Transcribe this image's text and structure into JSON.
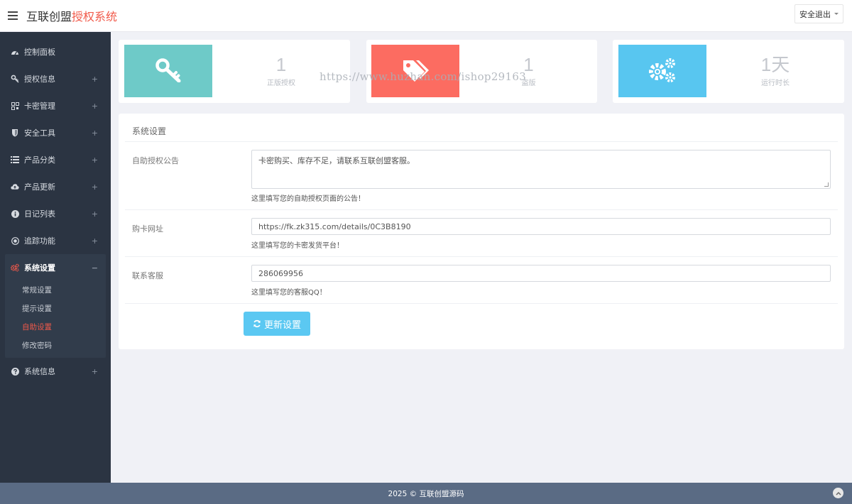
{
  "header": {
    "title_part1": "互联创盟",
    "title_part2": "授权系统",
    "logout_label": "安全退出"
  },
  "sidebar": {
    "items": [
      {
        "label": "控制面板",
        "icon": "dashboard-icon",
        "has_plus": false
      },
      {
        "label": "授权信息",
        "icon": "key-icon",
        "has_plus": true
      },
      {
        "label": "卡密管理",
        "icon": "qrcode-icon",
        "has_plus": true
      },
      {
        "label": "安全工具",
        "icon": "shield-icon",
        "has_plus": true
      },
      {
        "label": "产品分类",
        "icon": "list-icon",
        "has_plus": true
      },
      {
        "label": "产品更新",
        "icon": "cloud-upload-icon",
        "has_plus": true
      },
      {
        "label": "日记列表",
        "icon": "info-icon",
        "has_plus": true
      },
      {
        "label": "追踪功能",
        "icon": "target-icon",
        "has_plus": true
      }
    ],
    "active_group": {
      "label": "系统设置",
      "icon": "cogs-icon",
      "collapse": "−",
      "sub_items": [
        "常规设置",
        "提示设置",
        "自助设置",
        "修改密码"
      ],
      "active_sub": "自助设置"
    },
    "last_item": {
      "label": "系统信息",
      "icon": "question-icon",
      "has_plus": true
    },
    "plus": "+"
  },
  "stats": [
    {
      "value": "1",
      "label": "正版授权",
      "color": "#6ecac8",
      "icon": "key-icon"
    },
    {
      "value": "1",
      "label": "盗版",
      "color": "#fc6c61",
      "icon": "tags-icon"
    },
    {
      "value": "1天",
      "label": "运行时长",
      "color": "#58c6f0",
      "icon": "cogs-icon"
    }
  ],
  "watermark": "https://www.huzhan.com/ishop29163",
  "form": {
    "title": "系统设置",
    "fields": [
      {
        "label": "自助授权公告",
        "value": "卡密购买、库存不足，请联系互联创盟客服。",
        "help": "这里填写您的自助授权页面的公告！"
      },
      {
        "label": "购卡网址",
        "value": "https://fk.zk315.com/details/0C3B8190",
        "help": "这里填写您的卡密发货平台！"
      },
      {
        "label": "联系客服",
        "value": "286069956",
        "help": "这里填写您的客服QQ！"
      }
    ],
    "submit_label": "更新设置"
  },
  "footer": {
    "text": "2025 © 互联创盟源码"
  },
  "colors": {
    "sidebar_bg": "#2b3442",
    "accent_red": "#f0594a",
    "button_blue": "#5bc8f2",
    "footer_bg": "#5a6b84"
  }
}
